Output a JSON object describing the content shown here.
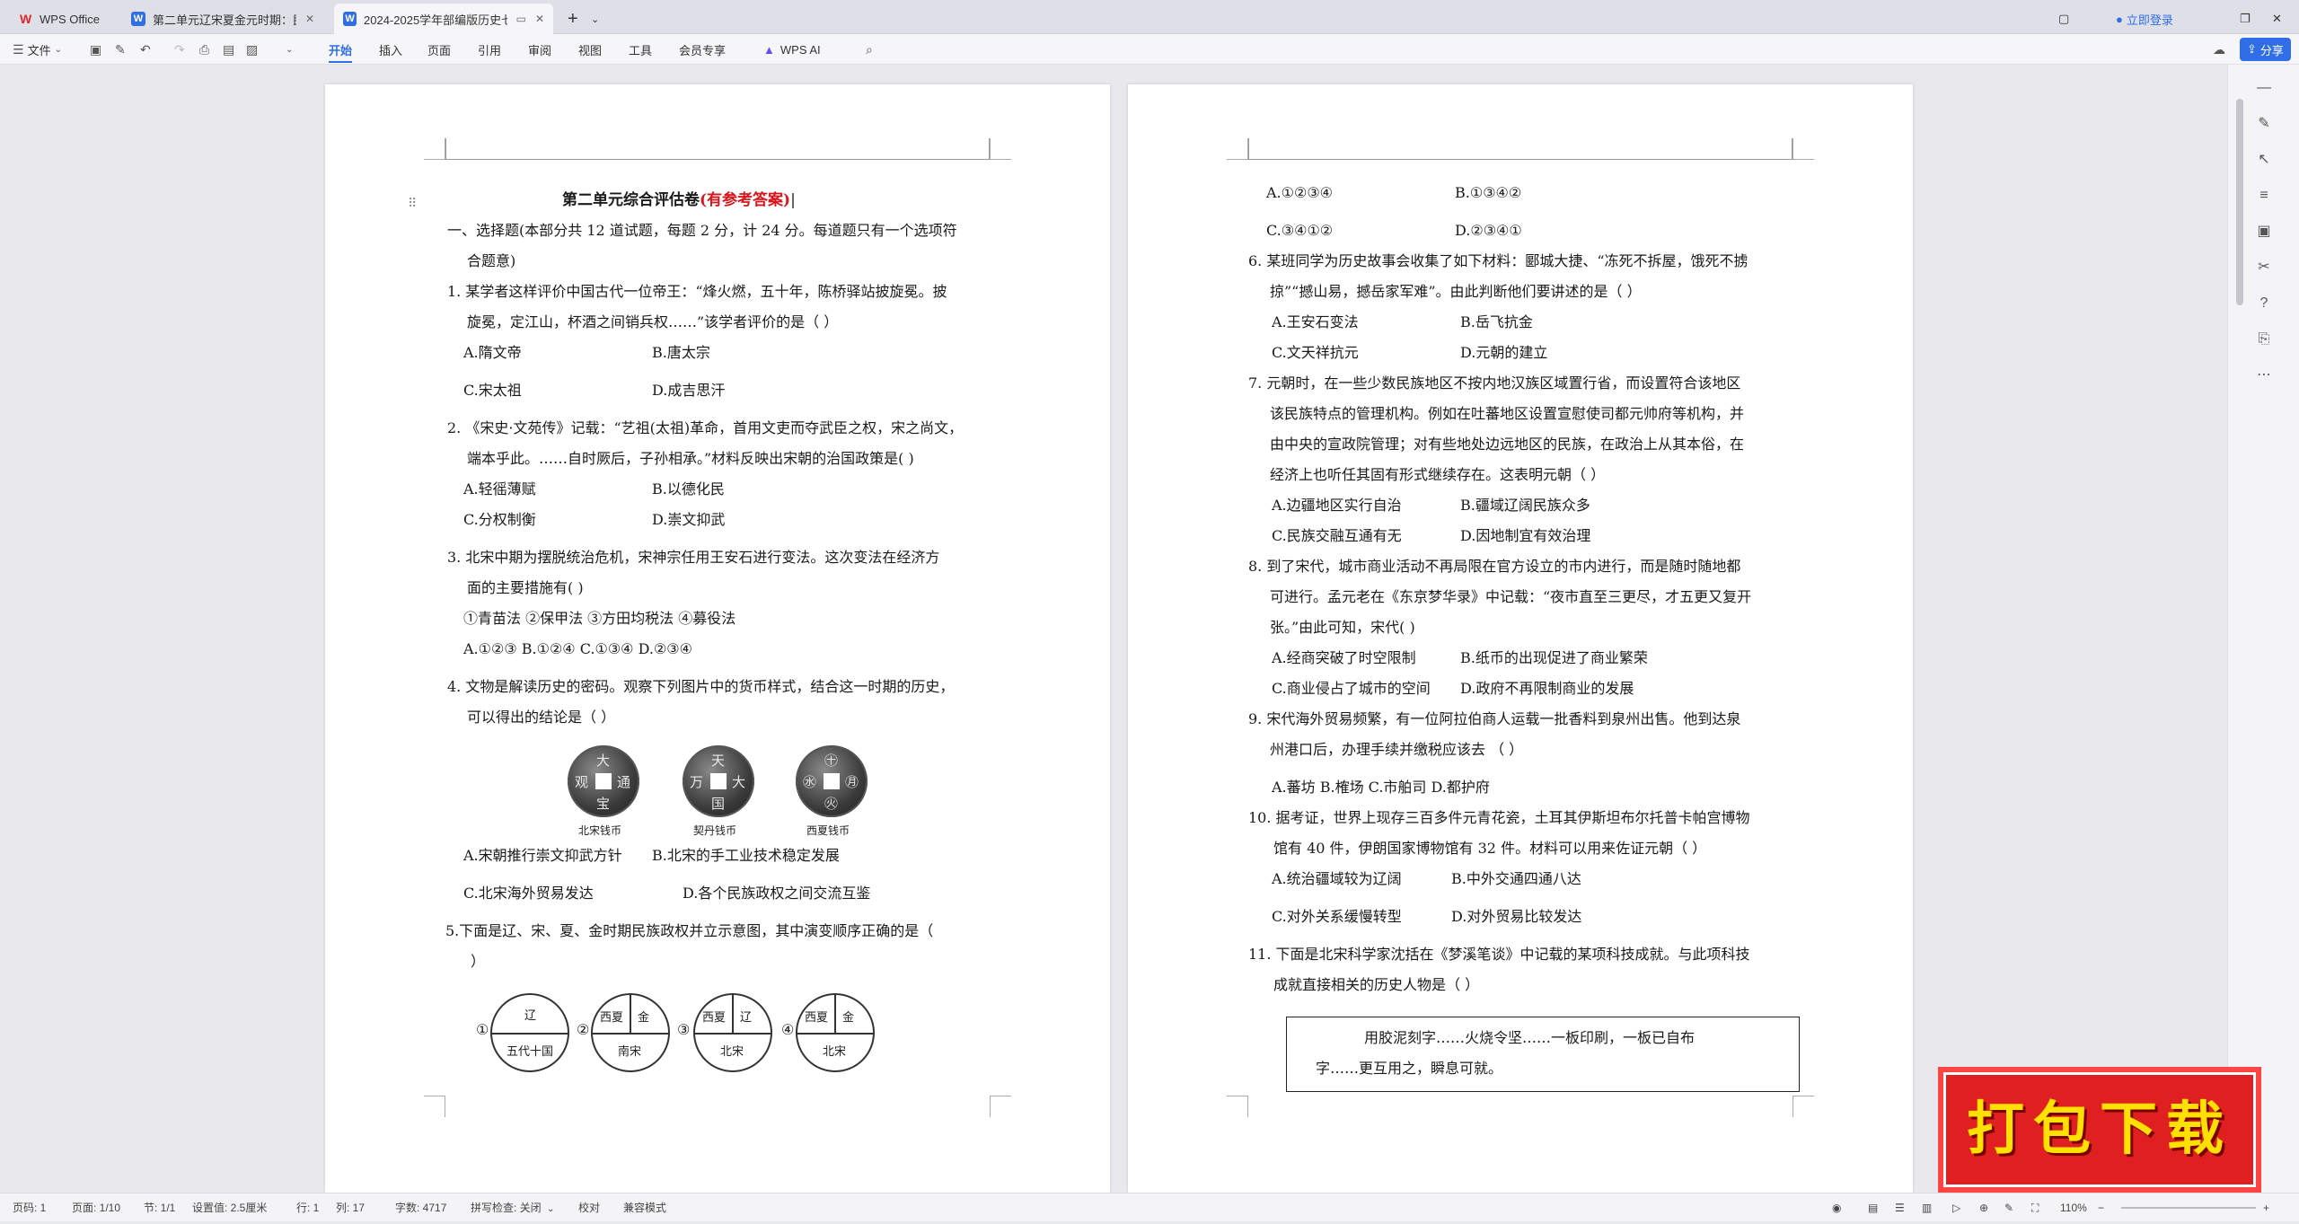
{
  "tabs": [
    {
      "label": "WPS Office"
    },
    {
      "label": "第二单元辽宋夏金元时期：民族关"
    },
    {
      "label": "2024-2025学年部编版历史七"
    }
  ],
  "window": {
    "login": "立即登录",
    "share": "分享"
  },
  "toolbar": {
    "file": "文件",
    "menus": [
      "开始",
      "插入",
      "页面",
      "引用",
      "审阅",
      "视图",
      "工具",
      "会员专享"
    ],
    "ai": "WPS AI"
  },
  "page1": {
    "title": "第二单元综合评估卷",
    "title_red": "(有参考答案)",
    "section": "一、选择题(本部分共 12 道试题，每题 2 分，计 24 分。每道题只有一个选项符",
    "section2": "合题意)",
    "q1a": "1.  某学者这样评价中国古代一位帝王：“烽火燃，五十年，陈桥驿站披旋冕。披",
    "q1b": "旋冕，定江山，杯酒之间销兵权……”该学者评价的是（     ）",
    "q1A": "A.隋文帝",
    "q1B": "B.唐太宗",
    "q1C": "C.宋太祖",
    "q1D": "D.成吉思汗",
    "q2a": "2.  《宋史·文苑传》记载：“艺祖(太祖)革命，首用文吏而夺武臣之权，宋之尚文，",
    "q2b": "端本乎此。……自时厥后，子孙相承。”材料反映出宋朝的治国政策是(     )",
    "q2A": "A.轻徭薄赋",
    "q2B": "B.以德化民",
    "q2C": "C.分权制衡",
    "q2D": "D.崇文抑武",
    "q3a": "3.  北宋中期为摆脱统治危机，宋神宗任用王安石进行变法。这次变法在经济方",
    "q3b": "面的主要措施有(     )",
    "q3items": "①青苗法        ②保甲法        ③方田均税法        ④募役法",
    "q3opts": "A.①②③      B.①②④      C.①③④      D.②③④",
    "q4a": "4.  文物是解读历史的密码。观察下列图片中的货币样式，结合这一时期的历史，",
    "q4b": "可以得出的结论是（     ）",
    "coins": [
      {
        "caption": "北宋钱币",
        "chars": [
          "大",
          "通",
          "宝",
          "观"
        ]
      },
      {
        "caption": "契丹钱币",
        "chars": [
          "天",
          "大",
          "国",
          "万"
        ]
      },
      {
        "caption": "西夏钱币",
        "chars": [
          "㊉",
          "㊊",
          "㊋",
          "㊌"
        ]
      }
    ],
    "q4A": "A.宋朝推行崇文抑武方针",
    "q4B": "B.北宋的手工业技术稳定发展",
    "q4C": "C.北宋海外贸易发达",
    "q4D": "D.各个民族政权之间交流互鉴",
    "q5a": "5.下面是辽、宋、夏、金时期民族政权并立示意图，其中演变顺序正确的是（",
    "q5b": "）",
    "diagrams": [
      {
        "num": "①",
        "top": "辽",
        "bottom": "五代十国"
      },
      {
        "num": "②",
        "tl": "西夏",
        "tr": "金",
        "bottom": "南宋"
      },
      {
        "num": "③",
        "tl": "西夏",
        "tr": "辽",
        "bottom": "北宋"
      },
      {
        "num": "④",
        "tl": "西夏",
        "tr": "金",
        "bottom": "北宋"
      }
    ]
  },
  "page2": {
    "q5A": "A.①②③④",
    "q5B": "B.①③④②",
    "q5C": "C.③④①②",
    "q5D": "D.②③④①",
    "q6a": "6.  某班同学为历史故事会收集了如下材料：郾城大捷、“冻死不拆屋，饿死不掳",
    "q6b": "掠”“撼山易，撼岳家军难”。由此判断他们要讲述的是（     ）",
    "q6A": "A.王安石变法",
    "q6B": "B.岳飞抗金",
    "q6C": "C.文天祥抗元",
    "q6D": "D.元朝的建立",
    "q7a": "7.  元朝时，在一些少数民族地区不按内地汉族区域置行省，而设置符合该地区",
    "q7b": "该民族特点的管理机构。例如在吐蕃地区设置宣慰使司都元帅府等机构，并",
    "q7c": "由中央的宣政院管理；对有些地处边远地区的民族，在政治上从其本俗，在",
    "q7d": "经济上也听任其固有形式继续存在。这表明元朝（     ）",
    "q7A": "A.边疆地区实行自治",
    "q7B": "B.疆域辽阔民族众多",
    "q7C": "C.民族交融互通有无",
    "q7D": "D.因地制宜有效治理",
    "q8a": "8.  到了宋代，城市商业活动不再局限在官方设立的市内进行，而是随时随地都",
    "q8b": "可进行。孟元老在《东京梦华录》中记载：“夜市直至三更尽，才五更又复开",
    "q8c": "张。”由此可知，宋代(     )",
    "q8A": "A.经商突破了时空限制",
    "q8B": "B.纸币的出现促进了商业繁荣",
    "q8C": "C.商业侵占了城市的空间",
    "q8D": "D.政府不再限制商业的发展",
    "q9a": "9.  宋代海外贸易频繁，有一位阿拉伯商人运载一批香料到泉州出售。他到达泉",
    "q9b": "州港口后，办理手续并缴税应该去     （     ）",
    "q9opts": "A.蕃坊        B.榷场          C.市舶司        D.都护府",
    "q10a": "10.  据考证，世界上现存三百多件元青花瓷，土耳其伊斯坦布尔托普卡帕宫博物",
    "q10b": "馆有 40 件，伊朗国家博物馆有 32 件。材料可以用来佐证元朝（     ）",
    "q10A": "A.统治疆域较为辽阔",
    "q10B": "B.中外交通四通八达",
    "q10C": "C.对外关系缓慢转型",
    "q10D": "D.对外贸易比较发达",
    "q11a": "11.  下面是北宋科学家沈括在《梦溪笔谈》中记载的某项科技成就。与此项科技",
    "q11b": "成就直接相关的历史人物是（     ）",
    "box1": "用胶泥刻字……火烧令坚……一板印刷，一板已自布",
    "box2": "字……更互用之，瞬息可就。"
  },
  "status": {
    "page": "页码: 1",
    "pages": "页面: 1/10",
    "section": "节: 1/1",
    "setting": "设置值: 2.5厘米",
    "row": "行: 1",
    "col": "列: 17",
    "words": "字数: 4717",
    "spell": "拼写检查: 关闭",
    "proof": "校对",
    "compat": "兼容模式",
    "zoom": "110%"
  },
  "promo": {
    "text": "打包下载"
  }
}
